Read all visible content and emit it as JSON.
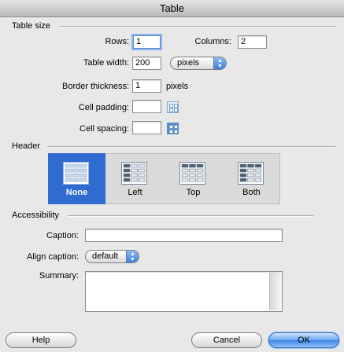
{
  "window": {
    "title": "Table"
  },
  "sections": {
    "table_size": "Table size",
    "header": "Header",
    "accessibility": "Accessibility"
  },
  "table_size": {
    "rows_label": "Rows:",
    "rows_value": "1",
    "columns_label": "Columns:",
    "columns_value": "2",
    "width_label": "Table width:",
    "width_value": "200",
    "width_unit": "pixels",
    "border_label": "Border thickness:",
    "border_value": "1",
    "border_unit": "pixels",
    "padding_label": "Cell padding:",
    "padding_value": "",
    "spacing_label": "Cell spacing:",
    "spacing_value": ""
  },
  "header": {
    "options": [
      {
        "label": "None",
        "selected": true
      },
      {
        "label": "Left",
        "selected": false
      },
      {
        "label": "Top",
        "selected": false
      },
      {
        "label": "Both",
        "selected": false
      }
    ]
  },
  "accessibility": {
    "caption_label": "Caption:",
    "caption_value": "",
    "align_label": "Align caption:",
    "align_value": "default",
    "summary_label": "Summary:",
    "summary_value": ""
  },
  "buttons": {
    "help": "Help",
    "cancel": "Cancel",
    "ok": "OK"
  },
  "colors": {
    "selected_bg": "#2f6bd0",
    "default_button": "#3f86e6"
  }
}
